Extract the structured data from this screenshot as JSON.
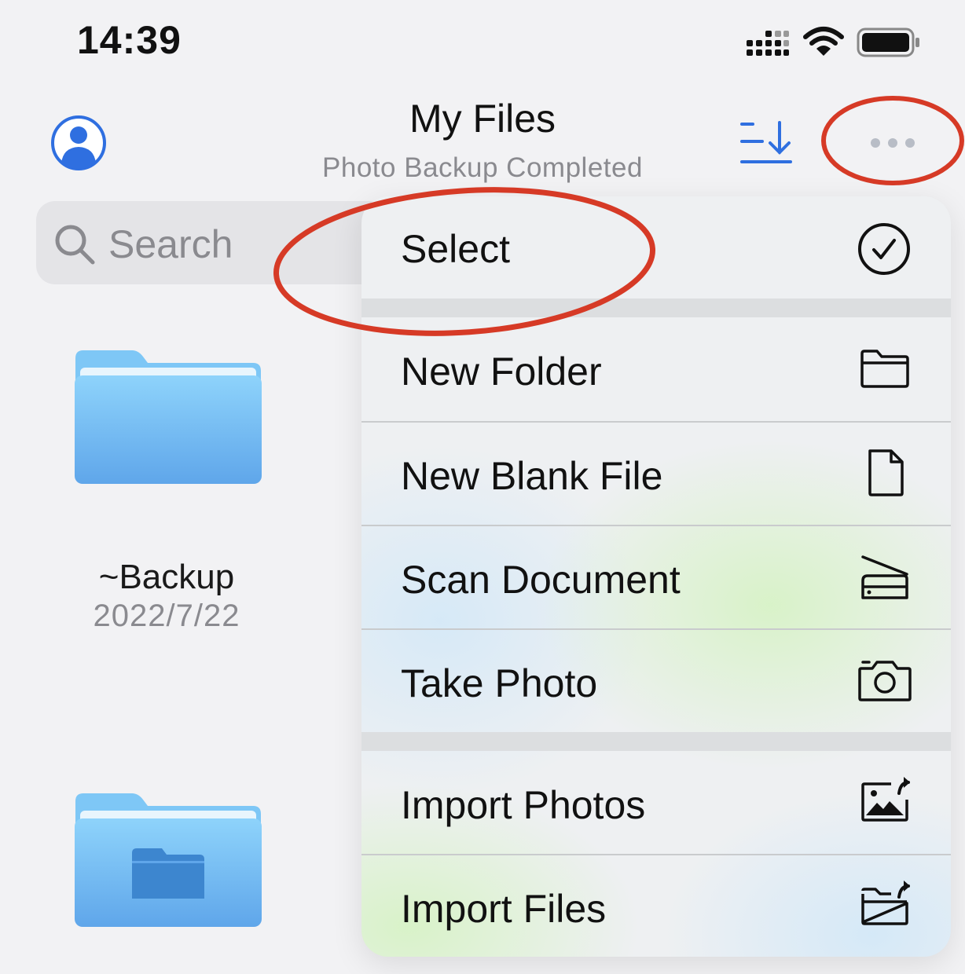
{
  "status_bar": {
    "time": "14:39"
  },
  "header": {
    "title": "My Files",
    "subtitle": "Photo Backup Completed",
    "icons": [
      "person-icon",
      "sort-download-icon",
      "more-icon"
    ]
  },
  "search": {
    "placeholder": "Search"
  },
  "files": [
    {
      "name": "~Backup",
      "date": "2022/7/22",
      "icon": "folder-icon"
    },
    {
      "name": "",
      "date": "",
      "icon": "folder-icon"
    }
  ],
  "menu": {
    "items": [
      {
        "label": "Select",
        "icon": "checkmark-circle-icon"
      },
      {
        "label": "New Folder",
        "icon": "folder-outline-icon"
      },
      {
        "label": "New Blank File",
        "icon": "document-icon"
      },
      {
        "label": "Scan Document",
        "icon": "scanner-icon"
      },
      {
        "label": "Take Photo",
        "icon": "camera-icon"
      },
      {
        "label": "Import Photos",
        "icon": "import-photo-icon"
      },
      {
        "label": "Import Files",
        "icon": "import-folder-icon"
      }
    ]
  },
  "colors": {
    "accent": "#2f6fe0",
    "annotation": "#d63a26",
    "folder": "#6fbdf3"
  }
}
